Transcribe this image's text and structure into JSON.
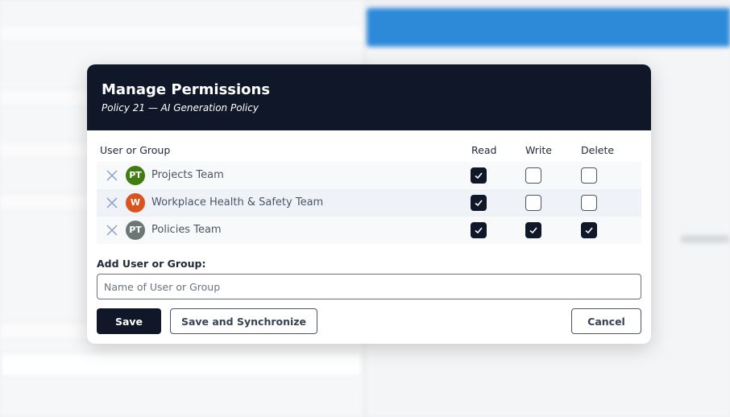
{
  "modal": {
    "title": "Manage Permissions",
    "subtitle": "Policy 21 — AI Generation Policy",
    "columns": {
      "name": "User or Group",
      "read": "Read",
      "write": "Write",
      "delete": "Delete"
    },
    "rows": [
      {
        "initials": "PT",
        "name": "Projects Team",
        "avatar_color": "#3f7d12",
        "read": true,
        "write": false,
        "delete": false
      },
      {
        "initials": "W",
        "name": "Workplace Health & Safety Team",
        "avatar_color": "#d9541e",
        "read": true,
        "write": false,
        "delete": false
      },
      {
        "initials": "PT",
        "name": "Policies Team",
        "avatar_color": "#6b7675",
        "read": true,
        "write": true,
        "delete": true
      }
    ],
    "add_label": "Add User or Group:",
    "add_placeholder": "Name of User or Group",
    "buttons": {
      "save": "Save",
      "save_sync": "Save and Synchronize",
      "cancel": "Cancel"
    }
  },
  "colors": {
    "header_bg": "#101729",
    "accent_bar": "#2d8ad9"
  },
  "icons": {
    "remove": "close-icon",
    "check": "check-icon"
  }
}
